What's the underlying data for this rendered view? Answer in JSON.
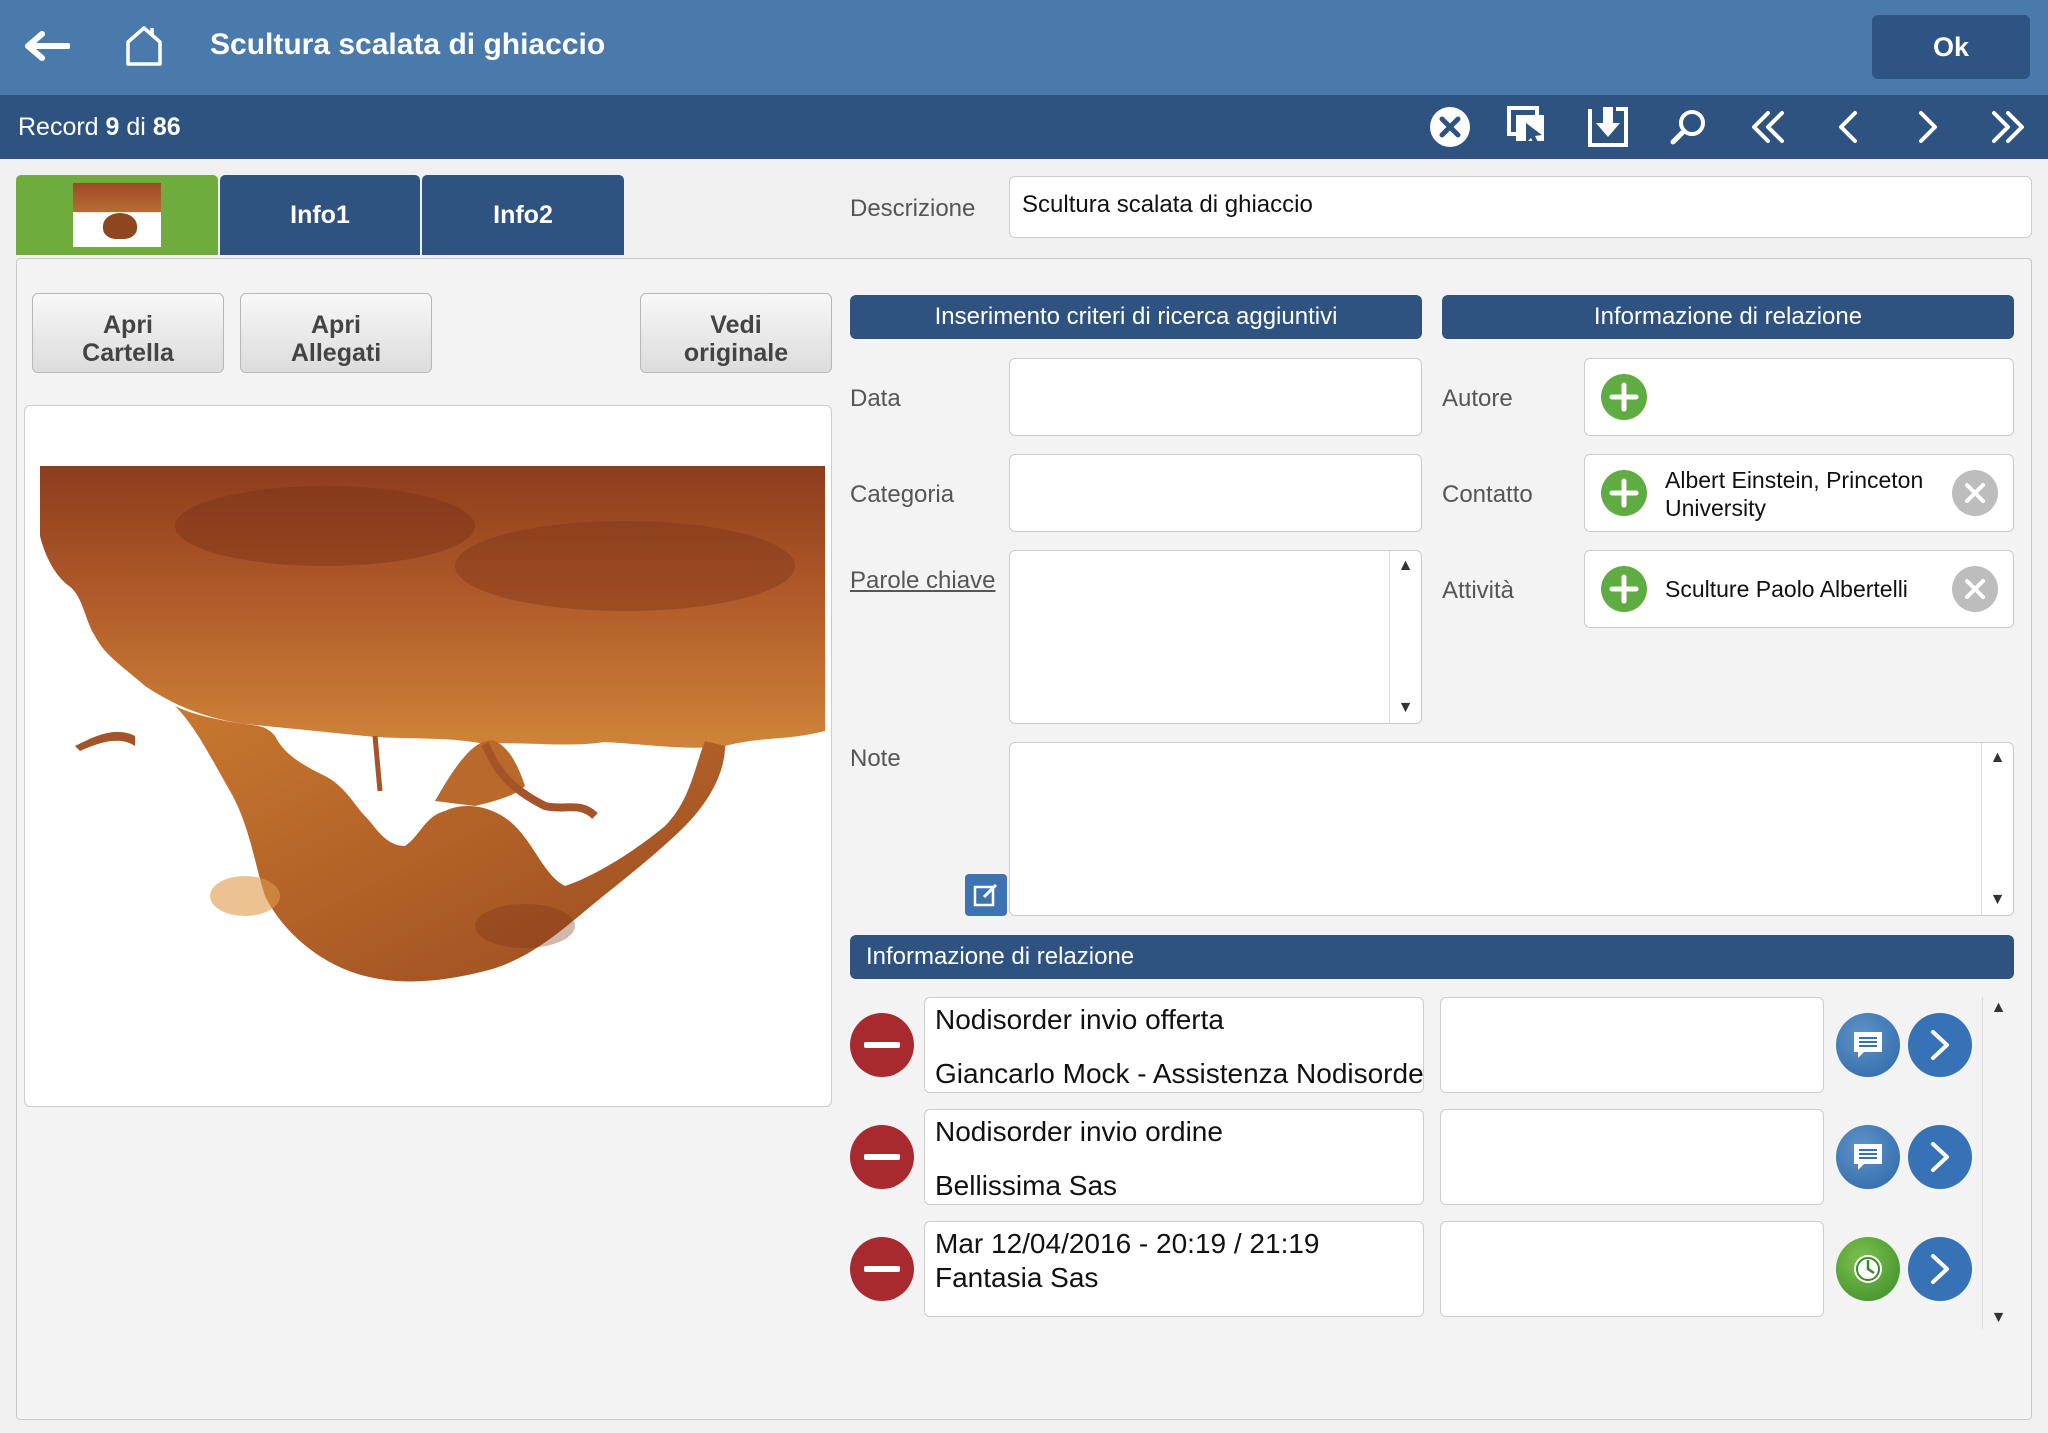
{
  "header": {
    "title": "Scultura scalata di ghiaccio",
    "ok_label": "Ok"
  },
  "navbar": {
    "record_word": "Record",
    "record_current": "9",
    "record_of": "di",
    "record_total": "86"
  },
  "tabs": [
    {
      "label": "Info1"
    },
    {
      "label": "Info2"
    }
  ],
  "description": {
    "label": "Descrizione",
    "value": "Scultura scalata di ghiaccio"
  },
  "buttons": {
    "open_folder_line1": "Apri",
    "open_folder_line2": "Cartella",
    "open_attach_line1": "Apri",
    "open_attach_line2": "Allegati",
    "see_original_line1": "Vedi",
    "see_original_line2": "originale"
  },
  "search_section": {
    "header": "Inserimento criteri di ricerca aggiuntivi",
    "data_label": "Data",
    "data_value": "",
    "category_label": "Categoria",
    "category_value": "",
    "keywords_label": "Parole chiave",
    "keywords_value": "",
    "note_label": "Note",
    "note_value": ""
  },
  "relation_section": {
    "header": "Informazione di relazione",
    "author_label": "Autore",
    "contact_label": "Contatto",
    "contact_value_line1": "Albert Einstein, Princeton",
    "contact_value_line2": "University",
    "activity_label": "Attività",
    "activity_value": "Sculture Paolo Albertelli"
  },
  "relations_list": {
    "header": "Informazione di relazione",
    "items": [
      {
        "line1": "Nodisorder invio offerta",
        "line2": "Giancarlo Mock - Assistenza Nodisorder",
        "icon": "message-icon"
      },
      {
        "line1": "Nodisorder invio ordine",
        "line2": "Bellissima Sas",
        "icon": "message-icon"
      },
      {
        "line1": "Mar 12/04/2016 - 20:19 / 21:19",
        "line2": "Fantasia Sas",
        "icon": "clock-icon"
      }
    ]
  },
  "colors": {
    "topbar": "#4a79ac",
    "navbar": "#2e5380",
    "active_tab": "#6fac3e",
    "add_green": "#5fad42",
    "remove_red": "#a8292e"
  }
}
